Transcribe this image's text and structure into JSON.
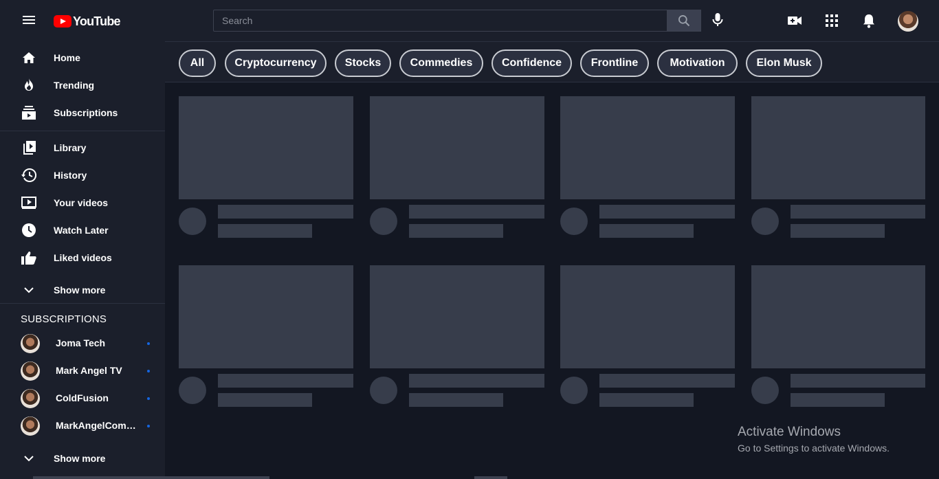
{
  "header": {
    "logo_text": "YouTube",
    "search": {
      "placeholder": "Search",
      "value": ""
    },
    "icons": [
      "menu-icon",
      "search-icon",
      "mic-icon",
      "create-video-icon",
      "apps-grid-icon",
      "bell-icon"
    ]
  },
  "sidebar": {
    "items": [
      {
        "label": "Home",
        "icon": "home-icon"
      },
      {
        "label": "Trending",
        "icon": "flame-icon"
      },
      {
        "label": "Subscriptions",
        "icon": "subscriptions-icon"
      },
      {
        "label": "Library",
        "icon": "library-icon"
      },
      {
        "label": "History",
        "icon": "history-icon"
      },
      {
        "label": "Your videos",
        "icon": "your-videos-icon"
      },
      {
        "label": "Watch Later",
        "icon": "clock-icon"
      },
      {
        "label": "Liked videos",
        "icon": "thumbs-up-icon"
      },
      {
        "label": "Show more",
        "icon": "chevron-down-icon"
      }
    ],
    "subscriptions_title": "SUBSCRIPTIONS",
    "subscriptions": [
      {
        "name": "Joma Tech"
      },
      {
        "name": "Mark Angel TV"
      },
      {
        "name": "ColdFusion"
      },
      {
        "name": "MarkAngelCome..."
      }
    ],
    "subs_show_more": "Show more",
    "new_content_dot_color": "#1565e0"
  },
  "chips": [
    "All",
    "Cryptocurrency",
    "Stocks",
    "Commedies",
    "Confidence",
    "Frontline",
    "Motivation",
    "Elon Musk"
  ],
  "watermark": {
    "line1": "Activate Windows",
    "line2": "Go to Settings to activate Windows."
  },
  "colors": {
    "background": "#131722",
    "panel": "#1b1f2b",
    "placeholder": "#373d4b",
    "logo_red": "#ff0000"
  }
}
